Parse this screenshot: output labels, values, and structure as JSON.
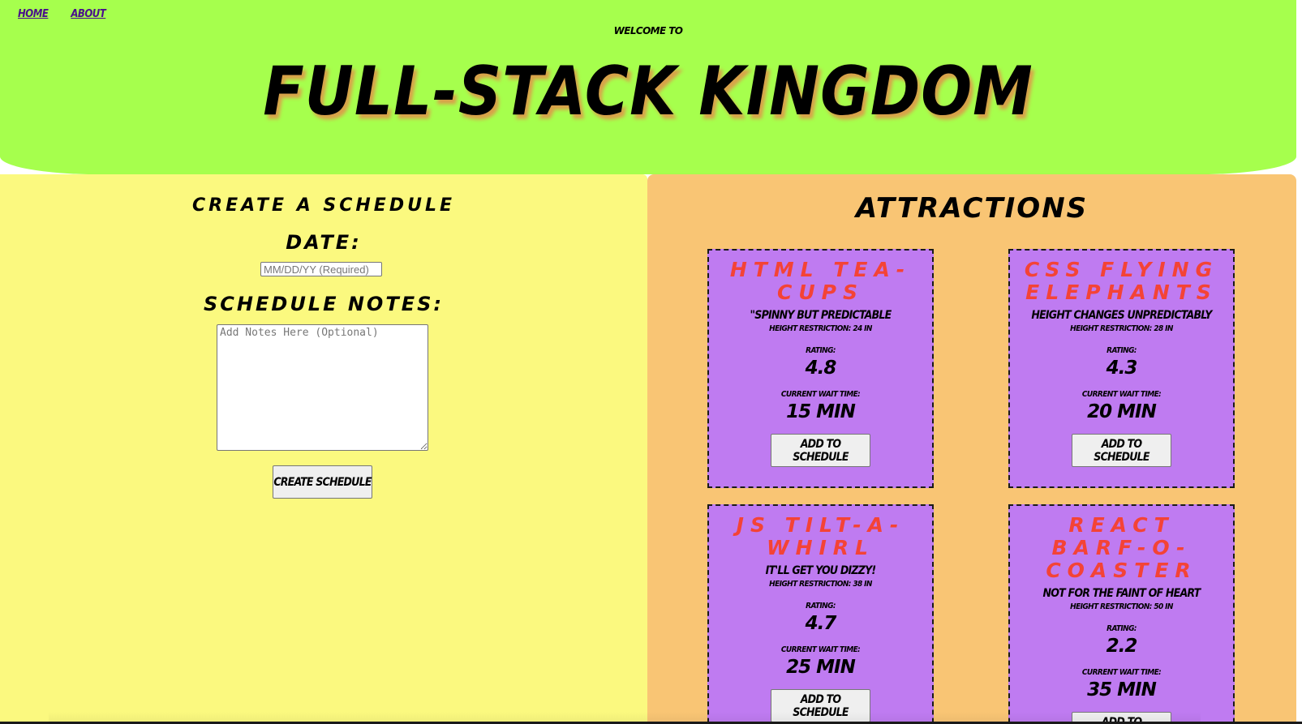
{
  "nav": {
    "home": "HOME",
    "about": "ABOUT"
  },
  "header": {
    "welcome": "WELCOME TO",
    "title": "FULL-STACK KINGDOM"
  },
  "schedule_form": {
    "title": "CREATE A SCHEDULE",
    "date_label": "DATE:",
    "date_placeholder": "MM/DD/YY (Required)",
    "notes_label": "SCHEDULE NOTES:",
    "notes_placeholder": "Add Notes Here (Optional)",
    "submit_label": "CREATE SCHEDULE"
  },
  "attractions": {
    "title": "ATTRACTIONS",
    "rating_label": "RATING:",
    "wait_label": "CURRENT WAIT TIME:",
    "add_label": "ADD TO SCHEDULE",
    "items": [
      {
        "name": "HTML TEA-CUPS",
        "description": "\"SPINNY BUT PREDICTABLE",
        "height": "HEIGHT RESTRICTION: 24 IN",
        "rating": "4.8",
        "wait": "15 MIN"
      },
      {
        "name": "CSS FLYING ELEPHANTS",
        "description": "HEIGHT CHANGES UNPREDICTABLY",
        "height": "HEIGHT RESTRICTION: 28 IN",
        "rating": "4.3",
        "wait": "20 MIN"
      },
      {
        "name": "JS TILT-A-WHIRL",
        "description": "IT'LL GET YOU DIZZY!",
        "height": "HEIGHT RESTRICTION: 38 IN",
        "rating": "4.7",
        "wait": "25 MIN"
      },
      {
        "name": "REACT BARF-O-COASTER",
        "description": "NOT FOR THE FAINT OF HEART",
        "height": "HEIGHT RESTRICTION: 50 IN",
        "rating": "2.2",
        "wait": "35 MIN"
      }
    ]
  },
  "colors": {
    "header_bg": "#a6ff4d",
    "schedule_bg": "#fbf97f",
    "attractions_bg": "#f9c574",
    "card_bg": "#bf7bf1",
    "card_title": "#f44336",
    "nav_link": "#4a0f8c"
  }
}
